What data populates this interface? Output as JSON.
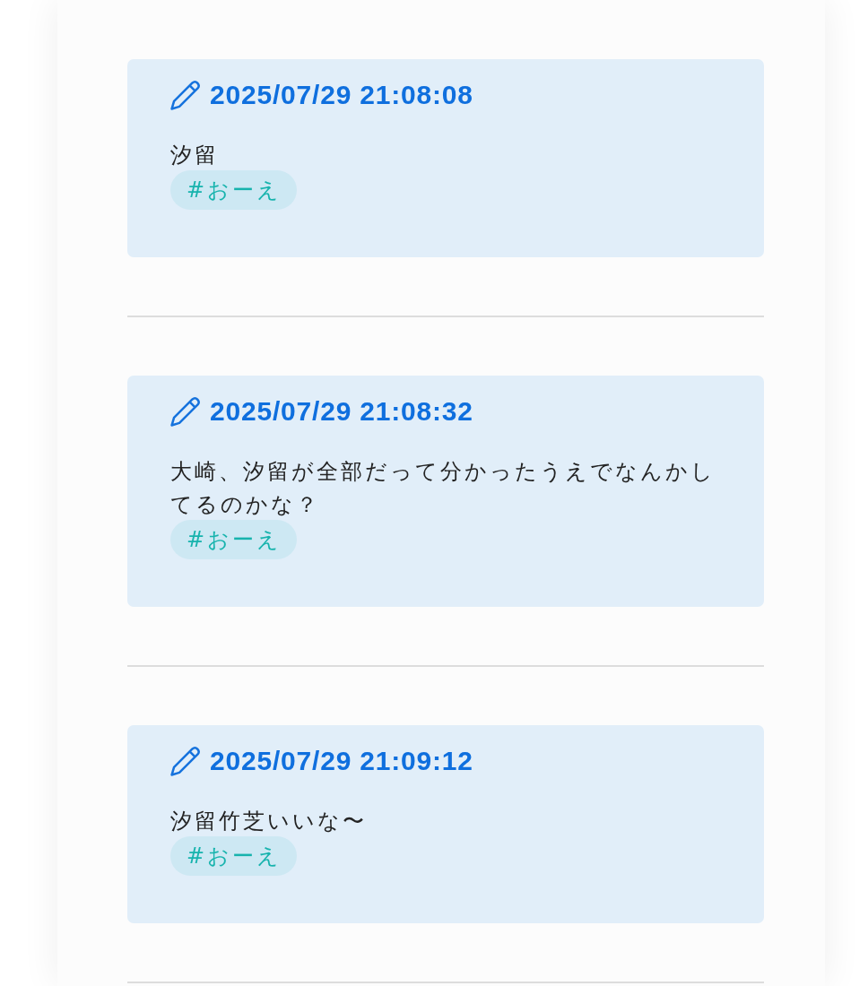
{
  "posts": [
    {
      "timestamp": "2025/07/29 21:08:08",
      "body": "汐留",
      "tags": [
        "#おーえ"
      ]
    },
    {
      "timestamp": "2025/07/29 21:08:32",
      "body": "大崎、汐留が全部だって分かったうえでなんかしてるのかな？",
      "tags": [
        "#おーえ"
      ]
    },
    {
      "timestamp": "2025/07/29 21:09:12",
      "body": "汐留竹芝いいな〜",
      "tags": [
        "#おーえ"
      ]
    }
  ]
}
